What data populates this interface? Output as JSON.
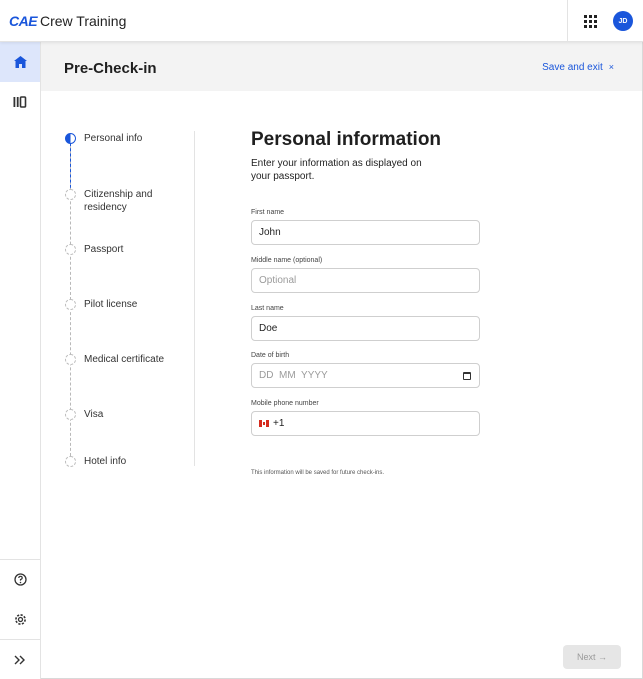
{
  "app": {
    "brand": "CAE",
    "title": "Crew Training",
    "user_initials": "JD"
  },
  "header": {
    "title": "Pre-Check-in",
    "save_exit": "Save and exit",
    "close_glyph": "×"
  },
  "rail": {
    "items": [
      "home-icon",
      "library-icon",
      "help-icon",
      "settings-icon",
      "expand-icon"
    ]
  },
  "stepper": {
    "active_index": 0,
    "steps": [
      {
        "label": "Personal info"
      },
      {
        "label": "Citizenship and residency"
      },
      {
        "label": "Passport"
      },
      {
        "label": "Pilot license"
      },
      {
        "label": "Medical certificate"
      },
      {
        "label": "Visa"
      },
      {
        "label": "Hotel info"
      }
    ]
  },
  "form": {
    "title": "Personal information",
    "subtitle": "Enter your information as displayed on your passport.",
    "first_name": {
      "label": "First name",
      "value": "John"
    },
    "middle_name": {
      "label": "Middle name (optional)",
      "placeholder": "Optional"
    },
    "last_name": {
      "label": "Last name",
      "value": "Doe"
    },
    "dob": {
      "label": "Date of birth",
      "placeholder": "DD  MM  YYYY"
    },
    "phone": {
      "label": "Mobile phone number",
      "country_code": "+1"
    },
    "note": "This information will be saved for future check-ins."
  },
  "footer": {
    "next_label": "Next",
    "next_arrow": "→"
  },
  "colors": {
    "accent": "#1a56db",
    "rail_active": "#dde6fb",
    "header_bg": "#f3f3f3"
  }
}
